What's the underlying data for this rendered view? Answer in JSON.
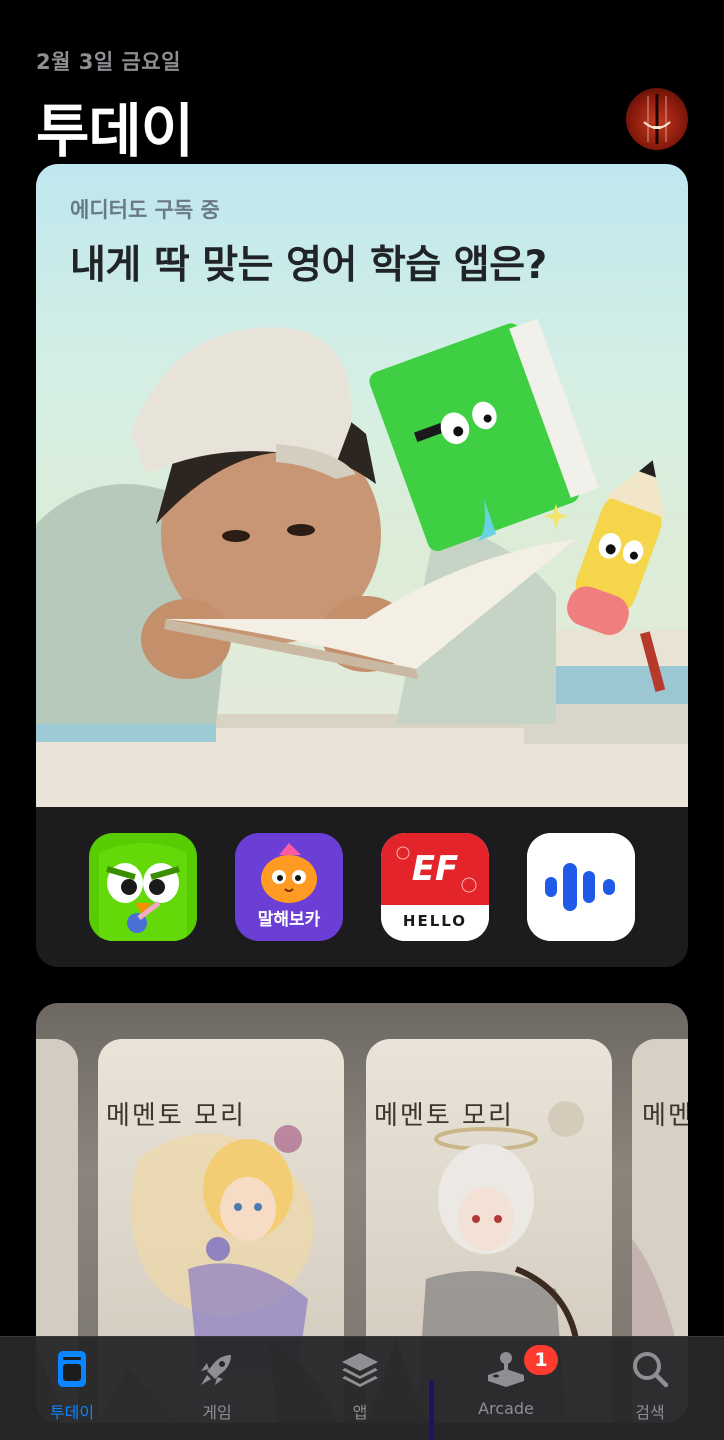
{
  "header": {
    "date": "2월 3일 금요일",
    "title": "투데이",
    "avatar_icon": "cello-avatar-icon"
  },
  "story_card": {
    "eyebrow": "에디터도 구독 중",
    "headline": "내게 딱 맞는 영어 학습 앱은?",
    "apps": [
      {
        "name": "duolingo-app-icon",
        "color": "#58cc02"
      },
      {
        "name": "malhaebo-ka-app-icon",
        "label": "말해보카",
        "color": "#6b3fd6"
      },
      {
        "name": "ef-hello-app-icon",
        "label": "HELLO",
        "logo": "EF",
        "color": "#e3242b"
      },
      {
        "name": "voice-app-icon",
        "color": "#ffffff"
      }
    ]
  },
  "game_card": {
    "poster_title": "메멘토 모리",
    "posters": [
      "poster-left-partial",
      "poster-1",
      "poster-2",
      "poster-right-partial"
    ]
  },
  "tabbar": {
    "tabs": [
      {
        "label": "투데이",
        "icon": "today-icon",
        "active": true
      },
      {
        "label": "게임",
        "icon": "rocket-icon",
        "active": false
      },
      {
        "label": "앱",
        "icon": "layers-icon",
        "active": false
      },
      {
        "label": "Arcade",
        "icon": "joystick-icon",
        "active": false
      },
      {
        "label": "검색",
        "icon": "search-icon",
        "active": false
      }
    ],
    "arcade_badge": "1"
  },
  "colors": {
    "accent": "#0a84ff",
    "badge": "#ff3b30",
    "background": "#000000"
  }
}
